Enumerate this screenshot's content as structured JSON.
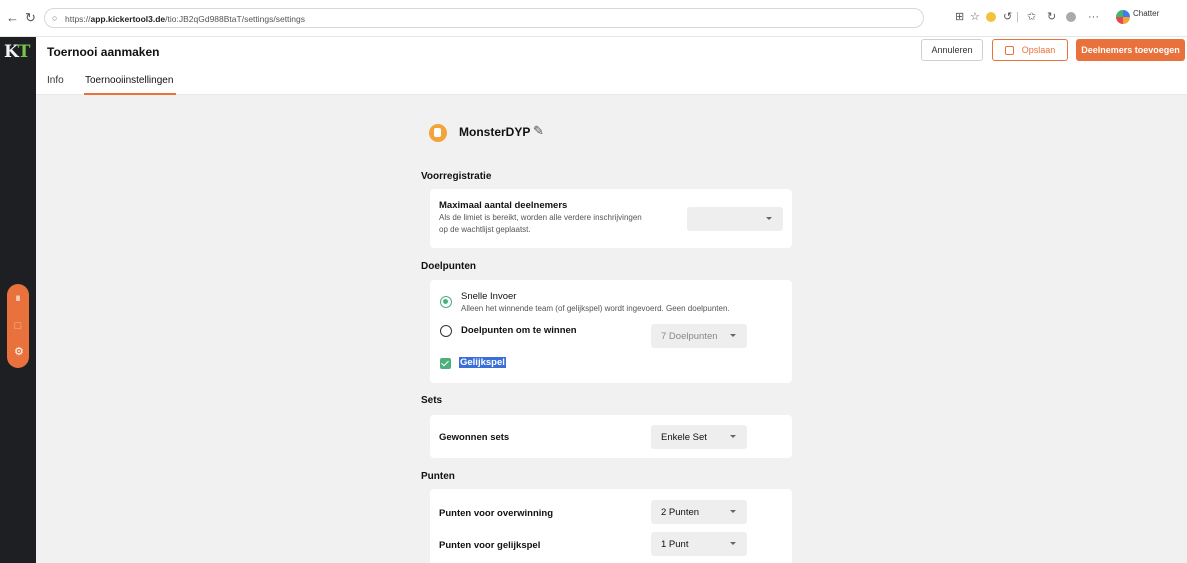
{
  "browser": {
    "url_prefix": "https://",
    "url_host": "app.kickertool3.de",
    "url_path": "/tio:JB2qGd988BtaT/settings/settings",
    "profile_label": "Chatter"
  },
  "sidebar": {
    "logo_k": "K",
    "logo_t": "T"
  },
  "header": {
    "title": "Toernooi aanmaken",
    "tabs": [
      {
        "label": "Info"
      },
      {
        "label": "Toernooiinstellingen"
      }
    ],
    "cancel_label": "Annuleren",
    "save_label": "Opslaan",
    "add_participants_label": "Deelnemers toevoegen"
  },
  "tournament": {
    "name": "MonsterDYP"
  },
  "preregistration": {
    "title": "Voorregistratie",
    "max_label": "Maximaal aantal deelnemers",
    "max_description_1": "Als de limiet is bereikt, worden alle verdere inschrijvingen",
    "max_description_2": "op de wachtlijst geplaatst.",
    "max_value": ""
  },
  "goals": {
    "title": "Doelpunten",
    "quick_entry_label": "Snelle Invoer",
    "quick_entry_description": "Alleen het winnende team (of gelijkspel) wordt ingevoerd. Geen doelpunten.",
    "goals_to_win_label": "Doelpunten om te winnen",
    "goals_to_win_value": "7 Doelpunten",
    "draw_label": "Gelijkspel",
    "selected_option": "Snelle Invoer",
    "draw_checked": true
  },
  "sets": {
    "title": "Sets",
    "won_sets_label": "Gewonnen sets",
    "won_sets_value": "Enkele Set"
  },
  "points": {
    "title": "Punten",
    "win_label": "Punten voor overwinning",
    "win_value": "2 Punten",
    "draw_label": "Punten voor gelijkspel",
    "draw_value": "1 Punt"
  },
  "colors": {
    "accent": "#e8713c",
    "success": "#4db07a",
    "sidebar_bg": "#1e1f22",
    "content_bg": "#f1f1f1"
  }
}
